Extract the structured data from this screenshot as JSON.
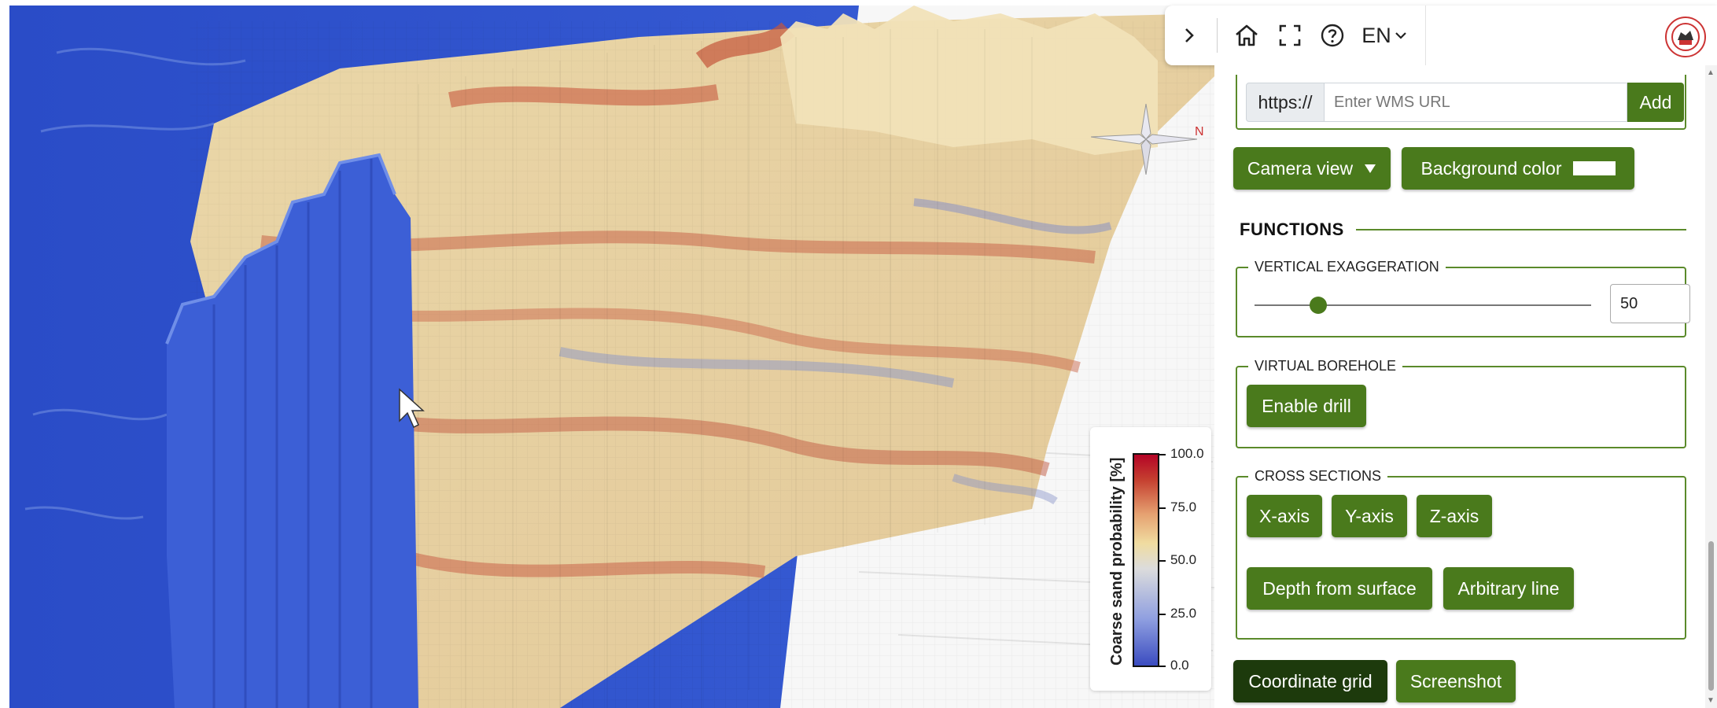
{
  "toolbar": {
    "collapse_icon": "chevron-right-icon",
    "home_icon": "home-icon",
    "fullscreen_icon": "fullscreen-icon",
    "help_icon": "help-circle-icon",
    "language": "EN",
    "language_icon": "chevron-down-icon",
    "logo_icon": "institution-logo"
  },
  "wms": {
    "prefix": "https://",
    "placeholder": "Enter WMS URL",
    "add_label": "Add"
  },
  "view_controls": {
    "camera_view_label": "Camera view",
    "camera_view_icon": "triangle-down-icon",
    "background_color_label": "Background color",
    "background_color_value": "#ffffff"
  },
  "functions": {
    "heading": "FUNCTIONS",
    "vertical_exaggeration": {
      "legend": "VERTICAL EXAGGERATION",
      "value": "50",
      "slider_fraction": 0.19
    },
    "virtual_borehole": {
      "legend": "VIRTUAL BOREHOLE",
      "enable_drill_label": "Enable drill"
    },
    "cross_sections": {
      "legend": "CROSS SECTIONS",
      "x_axis_label": "X-axis",
      "y_axis_label": "Y-axis",
      "z_axis_label": "Z-axis",
      "depth_label": "Depth from surface",
      "arbitrary_label": "Arbitrary line"
    },
    "coordinate_grid_label": "Coordinate grid",
    "screenshot_label": "Screenshot"
  },
  "legend": {
    "title": "Coarse sand probability [%]",
    "ticks": [
      "100.0",
      "75.0",
      "50.0",
      "25.0",
      "0.0"
    ],
    "colors": {
      "low": "#3b4cc0",
      "mid": "#dcdcdc",
      "high": "#b40426"
    }
  },
  "compass": {
    "north_label": "N",
    "icon": "compass-icon"
  },
  "colors": {
    "accent_green": "#4a7a1c",
    "dark_green": "#1d3a0c",
    "ocean_blue": "#2d4fc0"
  }
}
